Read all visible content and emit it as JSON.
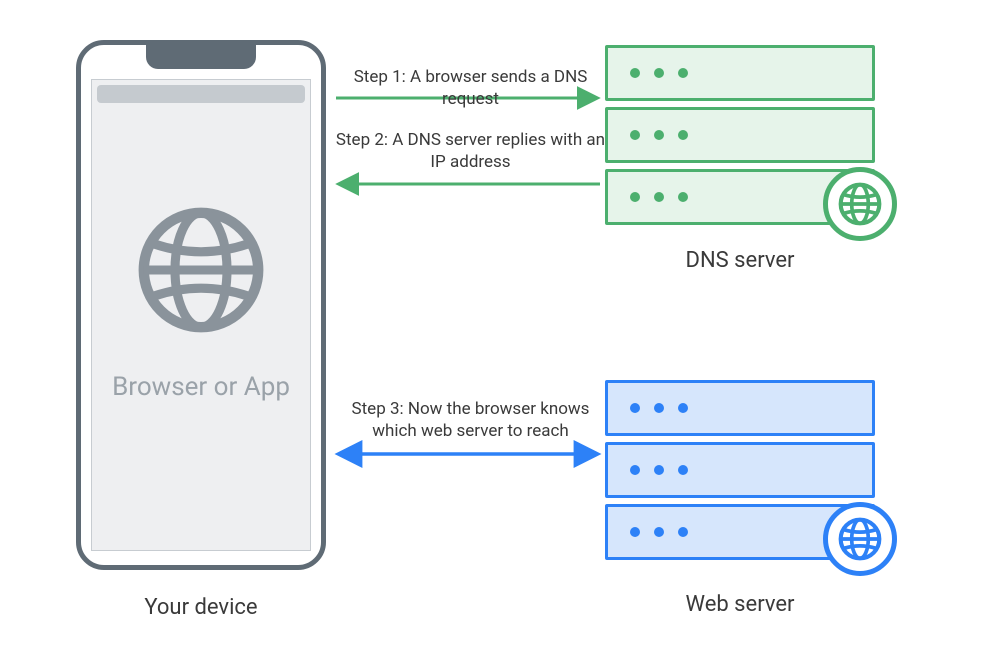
{
  "device": {
    "app_label": "Browser or App",
    "caption": "Your device"
  },
  "servers": {
    "dns": {
      "caption": "DNS server"
    },
    "web": {
      "caption": "Web server"
    }
  },
  "steps": {
    "s1": "Step 1: A browser sends a DNS request",
    "s2": "Step 2: A DNS server replies with an IP address",
    "s3": "Step 3: Now the browser knows which web server to reach"
  },
  "colors": {
    "phone": "#5f6b75",
    "dns": "#4caf6e",
    "web": "#2d81f7"
  }
}
